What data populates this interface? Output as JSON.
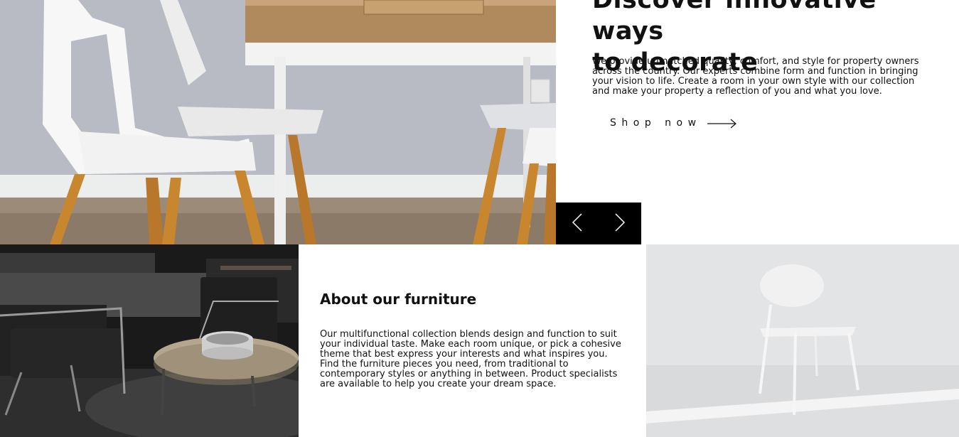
{
  "hero": {
    "title_line1": "Discover innovative ways",
    "title_line2": "to decorate",
    "description": "We provide unmatched quality, comfort, and style for property owners across the country. Our experts combine form and function in bringing your vision to life. Create a room in your own style with our collection and make your property a reflection of you and what you love.",
    "shop_label": "Shop now",
    "shop_icon": "arrow-right-icon",
    "image_alt": "White chairs with wooden legs around a dining table"
  },
  "slider": {
    "prev_icon": "chevron-left-icon",
    "next_icon": "chevron-right-icon"
  },
  "about": {
    "title": "About our furniture",
    "description": "Our multifunctional collection blends design and function to suit your individual taste. Make each room unique, or pick a cohesive theme that best express your interests and what inspires you. Find the furniture pieces you need, from traditional to contemporary styles or anything in between. Product specialists are available to help you create your dream space."
  },
  "colors": {
    "text": "#111111",
    "background": "#ffffff",
    "slider_bg": "#000000",
    "wood": "#c8862f"
  }
}
